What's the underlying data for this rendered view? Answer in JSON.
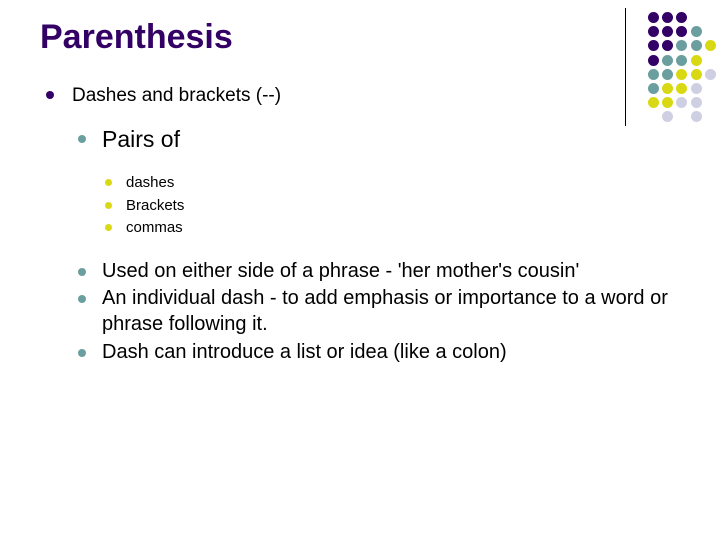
{
  "slide": {
    "title": "Parenthesis",
    "background_color": "#FFFFFF",
    "title_color": "#330066"
  },
  "ornament": {
    "name": "decorative-dot-grid",
    "rule_color": "#000000",
    "palette": {
      "purple": "#330066",
      "teal": "#6B9E9E",
      "yellow": "#D9D913",
      "lavender": "#CFCFE3"
    },
    "columns": 5,
    "rows": 8,
    "dots": [
      [
        "purple",
        "purple",
        "purple",
        null,
        null
      ],
      [
        "purple",
        "purple",
        "purple",
        "teal",
        null
      ],
      [
        "purple",
        "purple",
        "teal",
        "teal",
        "yellow"
      ],
      [
        "purple",
        "teal",
        "teal",
        "yellow",
        null
      ],
      [
        "teal",
        "teal",
        "yellow",
        "yellow",
        "lavender"
      ],
      [
        "teal",
        "yellow",
        "yellow",
        "lavender",
        null
      ],
      [
        "yellow",
        "yellow",
        "lavender",
        "lavender",
        null
      ],
      [
        null,
        "lavender",
        null,
        "lavender",
        null
      ]
    ]
  },
  "content": {
    "level1": [
      {
        "text": "Dashes and brackets (--)",
        "marker_color": "#330066"
      }
    ],
    "level2_heading": {
      "text": "Pairs of",
      "marker_color": "#6B9E9E"
    },
    "level3": [
      {
        "text": "dashes",
        "marker_color": "#D9D913"
      },
      {
        "text": "Brackets",
        "marker_color": "#D9D913"
      },
      {
        "text": "commas",
        "marker_color": "#D9D913"
      }
    ],
    "level2_points": [
      {
        "text": "Used on either side of a phrase - 'her mother's cousin'",
        "marker_color": "#6B9E9E"
      },
      {
        "text": "An individual dash - to add emphasis or importance to a word or phrase following it.",
        "marker_color": "#6B9E9E"
      },
      {
        "text": "Dash can introduce a list or idea (like a colon)",
        "marker_color": "#6B9E9E"
      }
    ]
  }
}
